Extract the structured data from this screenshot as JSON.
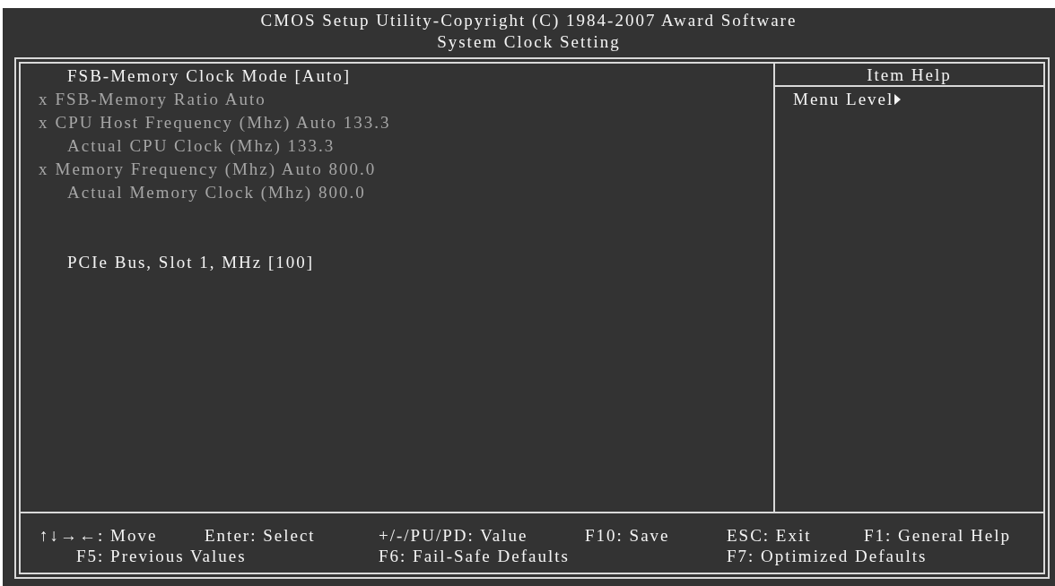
{
  "header": {
    "title": "CMOS Setup Utility-Copyright (C) 1984-2007 Award Software",
    "subtitle": "System Clock Setting"
  },
  "menu": {
    "sections": [
      {
        "items": [
          {
            "label": "FSB-Memory Clock Mode [Auto]",
            "disabled": false
          },
          {
            "marker": "x",
            "label": "FSB-Memory Ratio Auto",
            "disabled": true
          },
          {
            "marker": "x",
            "label": "CPU Host Frequency (Mhz) Auto 133.3",
            "disabled": true
          },
          {
            "label": "Actual CPU Clock (Mhz) 133.3",
            "disabled": true
          },
          {
            "marker": "x",
            "label": "Memory Frequency (Mhz) Auto 800.0",
            "disabled": true
          },
          {
            "label": "Actual Memory Clock (Mhz) 800.0",
            "disabled": true
          }
        ]
      },
      {
        "items": [
          {
            "label": "PCIe Bus, Slot 1, MHz [100]",
            "disabled": false
          }
        ]
      }
    ]
  },
  "item_help": {
    "title": "Item Help",
    "menu_level": "Menu Level"
  },
  "footer": {
    "rows": [
      [
        "↑↓→←: Move",
        "Enter: Select",
        "+/-/PU/PD: Value",
        "F10: Save",
        "ESC: Exit",
        "F1: General Help"
      ],
      [
        "F5: Previous Values",
        "",
        "F6: Fail-Safe Defaults",
        "",
        "F7: Optimized Defaults"
      ]
    ]
  }
}
